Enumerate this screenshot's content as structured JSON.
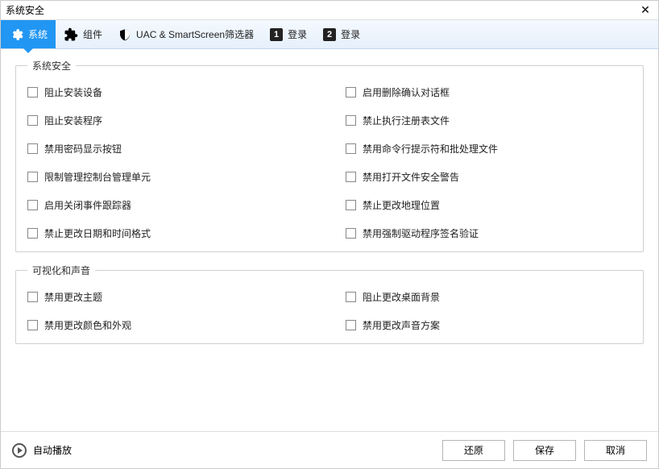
{
  "window": {
    "title": "系统安全"
  },
  "tabs": [
    {
      "label": "系统"
    },
    {
      "label": "组件"
    },
    {
      "label": "UAC & SmartScreen筛选器"
    },
    {
      "label": "登录",
      "badge": "1"
    },
    {
      "label": "登录",
      "badge": "2"
    }
  ],
  "groups": {
    "security": {
      "legend": "系统安全",
      "items": [
        "阻止安装设备",
        "启用删除确认对话框",
        "阻止安装程序",
        "禁止执行注册表文件",
        "禁用密码显示按钮",
        "禁用命令行提示符和批处理文件",
        "限制管理控制台管理单元",
        "禁用打开文件安全警告",
        "启用关闭事件跟踪器",
        "禁止更改地理位置",
        "禁止更改日期和时间格式",
        "禁用强制驱动程序签名验证"
      ]
    },
    "visual": {
      "legend": "可视化和声音",
      "items": [
        "禁用更改主题",
        "阻止更改桌面背景",
        "禁用更改颜色和外观",
        "禁用更改声音方案"
      ]
    }
  },
  "footer": {
    "autoplay": "自动播放",
    "restore": "还原",
    "save": "保存",
    "cancel": "取消"
  }
}
